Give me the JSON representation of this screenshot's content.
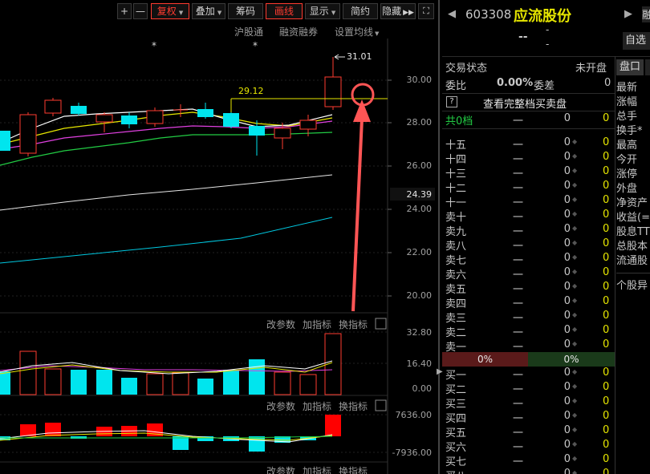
{
  "toolbar": {
    "plus": "+",
    "minus": "—",
    "fuquan": "复权",
    "diejia": "叠加",
    "chouma": "筹码",
    "huaxian": "画线",
    "xianshi": "显示",
    "jianyue": "简约",
    "yincang": "隐藏"
  },
  "links": {
    "hugutong": "沪股通",
    "rongzi": "融资融券",
    "shezhi": "设置均线"
  },
  "chart": {
    "star": "*",
    "high_label": "31.01",
    "line_label": "29.12",
    "price_axis": [
      "30.00",
      "28.00",
      "26.00",
      "24.00",
      "22.00",
      "20.00"
    ],
    "current_price": "24.39",
    "vol_axis": [
      "32.80",
      "16.40",
      "0.00"
    ],
    "macd_axis": [
      "7636.00",
      "-7936.00"
    ]
  },
  "indicator_links": {
    "gaicanshu": "改参数",
    "jiazhibiao": "加指标",
    "huanzhibiao": "换指标"
  },
  "stock": {
    "code": "603308",
    "name": "应流股份",
    "dash1": "--",
    "dash2": "-",
    "dash3": "-"
  },
  "top_right": {
    "rong": "融",
    "zixuan": "自选"
  },
  "trade": {
    "status_label": "交易状态",
    "status_value": "未开盘",
    "weibi_label": "委比",
    "weibi_value": "0.00%",
    "weicha_label": "委差",
    "weicha_value": "0",
    "full_label": "查看完整档买卖盘",
    "q_mark": "?",
    "gong_label": "共0档",
    "gong_dash": "一",
    "gong_v1": "0",
    "gong_v2": "0"
  },
  "sell_rows": [
    "十五",
    "十四",
    "十三",
    "十二",
    "十一",
    "卖十",
    "卖九",
    "卖八",
    "卖七",
    "卖六",
    "卖五",
    "卖四",
    "卖三",
    "卖二",
    "卖一"
  ],
  "buy_rows": [
    "买一",
    "买二",
    "买三",
    "买四",
    "买五",
    "买六",
    "买七",
    "买八"
  ],
  "row_dash": "一",
  "row_zero": "0",
  "pct_left": "0%",
  "pct_right": "0%",
  "right_tabs": {
    "pankou": "盘口",
    "items": [
      "最新",
      "涨幅",
      "总手",
      "换手*",
      "最高",
      "今开",
      "涨停",
      "外盘",
      "净资产",
      "收益(=",
      "股息TT",
      "总股本",
      "流通股"
    ],
    "geguyi": "个股异"
  },
  "colors": {
    "up": "#ff3b30",
    "down": "#00e5ee",
    "accent": "#e6e600"
  }
}
